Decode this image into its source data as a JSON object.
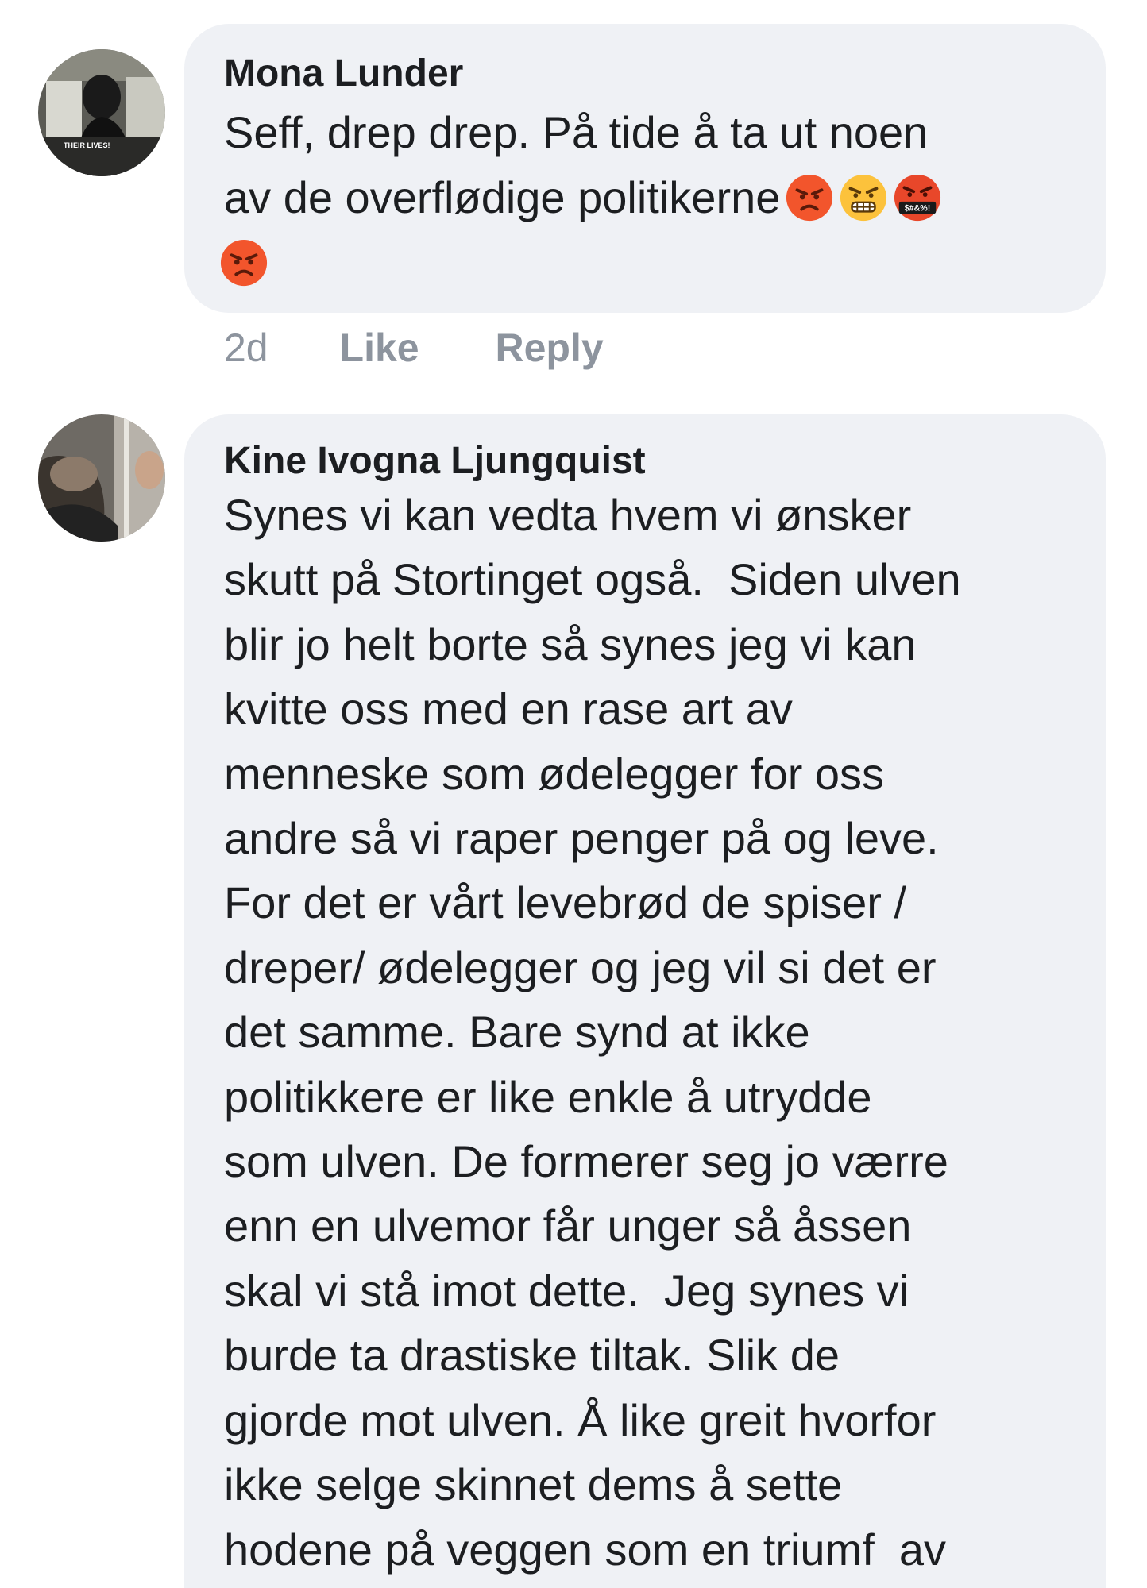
{
  "comments": [
    {
      "author": "Mona Lunder",
      "avatar_icon": "profile-photo",
      "avatar_overlay_text": "THEIR LIVES!",
      "lines": [
        "Seff, drep drep. På tide å ta ut noen",
        "av de overflødige politikerne"
      ],
      "emojis": [
        "angry-face-icon",
        "grimacing-angry-face-icon",
        "cursing-face-icon",
        "angry-face-icon"
      ],
      "cursing_symbols": "$#&%!",
      "timestamp": "2d",
      "like_label": "Like",
      "reply_label": "Reply"
    },
    {
      "author": "Kine Ivogna Ljungquist",
      "avatar_icon": "profile-photo",
      "lines": [
        "Synes vi kan vedta hvem vi ønsker",
        "skutt på Stortinget også.  Siden ulven",
        "blir jo helt borte så synes jeg vi kan",
        "kvitte oss med en rase art av",
        "menneske som ødelegger for oss",
        "andre så vi raper penger på og leve.",
        "For det er vårt levebrød de spiser /",
        "dreper/ ødelegger og jeg vil si det er",
        "det samme. Bare synd at ikke",
        "politikkere er like enkle å utrydde",
        "som ulven. De formerer seg jo værre",
        "enn en ulvemor får unger så åssen",
        "skal vi stå imot dette.  Jeg synes vi",
        "burde ta drastiske tiltak. Slik de",
        "gjorde mot ulven. Å like greit hvorfor",
        "ikke selge skinnet dems å sette",
        "hodene på veggen som en triumf  av"
      ]
    }
  ],
  "colors": {
    "bubble": "#eff1f5",
    "text": "#1c1e21",
    "meta": "#8d949e"
  }
}
